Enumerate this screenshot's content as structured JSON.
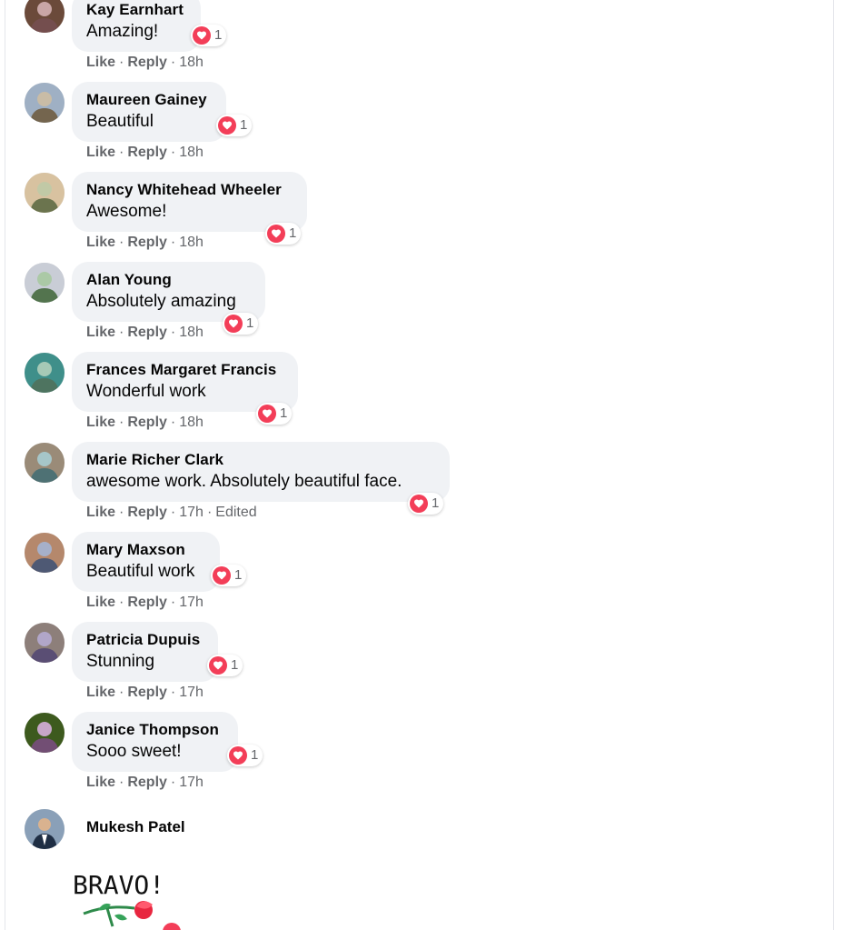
{
  "comments": [
    {
      "author": "Kay Earnhart",
      "text": "Amazing!",
      "reactions": "1",
      "like": "Like",
      "reply": "Reply",
      "time": "18h",
      "edited": "",
      "avatar_color": "#6b4a3a"
    },
    {
      "author": "Maureen Gainey",
      "text": "Beautiful",
      "reactions": "1",
      "like": "Like",
      "reply": "Reply",
      "time": "18h",
      "edited": "",
      "avatar_color": "#9fb0c4"
    },
    {
      "author": "Nancy Whitehead Wheeler",
      "text": "Awesome!",
      "reactions": "1",
      "like": "Like",
      "reply": "Reply",
      "time": "18h",
      "edited": "",
      "avatar_color": "#d8c2a0"
    },
    {
      "author": "Alan Young",
      "text": "Absolutely amazing",
      "reactions": "1",
      "like": "Like",
      "reply": "Reply",
      "time": "18h",
      "edited": "",
      "avatar_color": "#c9cdd6"
    },
    {
      "author": "Frances Margaret Francis",
      "text": "Wonderful work",
      "reactions": "1",
      "like": "Like",
      "reply": "Reply",
      "time": "18h",
      "edited": "",
      "avatar_color": "#3f8f8a"
    },
    {
      "author": "Marie Richer Clark",
      "text": "awesome work. Absolutely beautiful face.",
      "reactions": "1",
      "like": "Like",
      "reply": "Reply",
      "time": "17h",
      "edited": "Edited",
      "avatar_color": "#9a8b78"
    },
    {
      "author": "Mary Maxson",
      "text": "Beautiful work",
      "reactions": "1",
      "like": "Like",
      "reply": "Reply",
      "time": "17h",
      "edited": "",
      "avatar_color": "#b5886c"
    },
    {
      "author": "Patricia Dupuis",
      "text": "Stunning",
      "reactions": "1",
      "like": "Like",
      "reply": "Reply",
      "time": "17h",
      "edited": "",
      "avatar_color": "#8d7f7a"
    },
    {
      "author": "Janice Thompson",
      "text": "Sooo sweet!",
      "reactions": "1",
      "like": "Like",
      "reply": "Reply",
      "time": "17h",
      "edited": "",
      "avatar_color": "#3d5a1e"
    }
  ],
  "last_comment": {
    "author": "Mukesh Patel",
    "sticker_text": "BRAVO!",
    "avatar_color": "#2c3e58"
  },
  "colors": {
    "heart": "#f33e58",
    "bubble": "#f0f2f5",
    "meta_text": "#65676b"
  },
  "icons": [
    "heart-reaction-icon",
    "rose-icon",
    "avatar"
  ]
}
